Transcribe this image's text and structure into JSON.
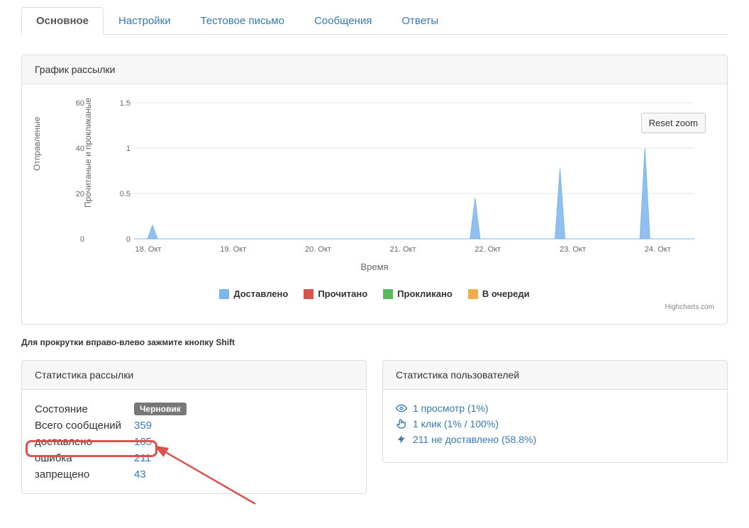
{
  "tabs": {
    "main": "Основное",
    "settings": "Настройки",
    "test_letter": "Тестовое письмо",
    "messages": "Сообщения",
    "replies": "Ответы"
  },
  "chart_panel_title": "График рассылки",
  "reset_zoom": "Reset zoom",
  "y1_label": "Отправленые",
  "y2_label": "Прочитаные и прокликаные",
  "x_title": "Время",
  "legend": {
    "delivered": "Доставлено",
    "read": "Прочитано",
    "clicked": "Прокликано",
    "queued": "В очереди"
  },
  "legend_colors": {
    "delivered": "#7cb5ec",
    "read": "#d9534f",
    "clicked": "#5cb85c",
    "queued": "#f0ad4e"
  },
  "credit": "Highcharts.com",
  "scroll_hint": "Для прокрутки вправо-влево зажмите кнопку Shift",
  "stats_panel_title": "Статистика рассылки",
  "stats": {
    "state_label": "Состояние",
    "state_badge": "Черновик",
    "total_label": "Всего сообщений",
    "total_value": "359",
    "delivered_label": "доставлено",
    "delivered_value": "105",
    "error_label": "ошибка",
    "error_value": "211",
    "forbidden_label": "запрещено",
    "forbidden_value": "43"
  },
  "user_stats_panel_title": "Статистика пользователей",
  "user_stats": {
    "views": "1 просмотр (1%)",
    "clicks": "1 клик (1% / 100%)",
    "undelivered": "211 не доставлено (58.8%)"
  },
  "chart_data": {
    "type": "area",
    "title": "График рассылки",
    "xlabel": "Время",
    "ylabel_left": "Отправленые",
    "ylabel_right": "Прочитаные и прокликаные",
    "y_left_ticks": [
      0,
      20,
      40,
      60
    ],
    "y_right_ticks": [
      0,
      0.5,
      1,
      1.5
    ],
    "y_left_range": [
      0,
      60
    ],
    "y_right_range": [
      0,
      1.5
    ],
    "categories": [
      "18. Окт",
      "19. Окт",
      "20. Окт",
      "21. Окт",
      "22. Окт",
      "23. Окт",
      "24. Окт"
    ],
    "legend": [
      "Доставлено",
      "Прочитано",
      "Прокликано",
      "В очереди"
    ],
    "series": [
      {
        "name": "Доставлено",
        "axis": "left",
        "color": "#7cb5ec",
        "peaks": [
          {
            "x_index": 0.05,
            "value": 6
          },
          {
            "x_index": 3.85,
            "value": 18
          },
          {
            "x_index": 4.85,
            "value": 31
          },
          {
            "x_index": 5.85,
            "value": 40
          }
        ]
      },
      {
        "name": "Прочитано",
        "axis": "right",
        "color": "#d9534f",
        "peaks": []
      },
      {
        "name": "Прокликано",
        "axis": "right",
        "color": "#5cb85c",
        "peaks": []
      },
      {
        "name": "В очереди",
        "axis": "left",
        "color": "#f0ad4e",
        "peaks": []
      }
    ]
  }
}
